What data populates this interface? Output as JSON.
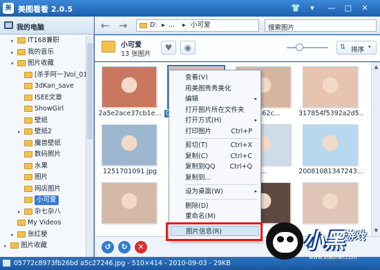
{
  "window": {
    "app_icon": "美",
    "title": "美图看看 2.0.5",
    "controls": [
      "shirt-icon",
      "menu-icon",
      "minimize-icon",
      "maximize-icon",
      "close-icon"
    ]
  },
  "sidebar": {
    "root_label": "我的电脑",
    "items": [
      {
        "label": "IT168兼职",
        "indent": 1,
        "expander": "▸"
      },
      {
        "label": "我的音乐",
        "indent": 1,
        "expander": "▸"
      },
      {
        "label": "图片收藏",
        "indent": 1,
        "expander": "▾"
      },
      {
        "label": "[杀手阿一]Vol_01",
        "indent": 2,
        "expander": ""
      },
      {
        "label": "3dKan_save",
        "indent": 2,
        "expander": ""
      },
      {
        "label": "ISEE文章",
        "indent": 2,
        "expander": ""
      },
      {
        "label": "ShowGirl",
        "indent": 2,
        "expander": ""
      },
      {
        "label": "壁纸",
        "indent": 2,
        "expander": ""
      },
      {
        "label": "壁纸2",
        "indent": 2,
        "expander": "▸"
      },
      {
        "label": "魔兽壁纸",
        "indent": 2,
        "expander": ""
      },
      {
        "label": "数码照片",
        "indent": 2,
        "expander": ""
      },
      {
        "label": "水果",
        "indent": 2,
        "expander": ""
      },
      {
        "label": "图片",
        "indent": 2,
        "expander": ""
      },
      {
        "label": "网店图片",
        "indent": 2,
        "expander": ""
      },
      {
        "label": "小可爱",
        "indent": 2,
        "expander": "",
        "selected": true
      },
      {
        "label": "杂七杂八",
        "indent": 2,
        "expander": "▸"
      },
      {
        "label": "My Videos",
        "indent": 1,
        "expander": ""
      },
      {
        "label": "张红梗",
        "indent": 1,
        "expander": "▸"
      },
      {
        "label": "图片收藏",
        "indent": 0,
        "expander": "▸"
      }
    ]
  },
  "toolbar": {
    "back": "←",
    "forward": "→",
    "path": {
      "drive": "D:",
      "sep1": "▸",
      "ellipsis": "...",
      "sep2": "▸",
      "folder": "小可爱"
    },
    "search_placeholder": "搜索图片"
  },
  "folder_header": {
    "name": "小可爱",
    "count": "13 张图片",
    "favorite_icon": "♥",
    "view_icon": "◉",
    "zoom_level": 0.3,
    "sort_label": "排序",
    "sort_arrow": "▾",
    "sort_icon": "⇅"
  },
  "thumbnails": [
    {
      "caption": "2a5e2ace37cb1e...",
      "color": "#c9785f",
      "selected": false
    },
    {
      "caption": "05772c8973fb26...",
      "color": "#e3b8a2",
      "selected": true
    },
    {
      "caption": "...9462c...",
      "color": "#d8b5a0",
      "selected": false
    },
    {
      "caption": "317854f5392a2d5...",
      "color": "#e7c3b0",
      "selected": false
    },
    {
      "caption": "1251701091.jpg",
      "color": "#9cb7cf",
      "selected": false
    },
    {
      "caption": "...",
      "color": "#b4c8dc",
      "selected": false
    },
    {
      "caption": "...",
      "color": "#cfdbe6",
      "selected": false
    },
    {
      "caption": "20081081347243...",
      "color": "#b7d8ee",
      "selected": false
    },
    {
      "caption": "",
      "color": "#d5b8a6",
      "selected": false
    },
    {
      "caption": "",
      "color": "#c7a593",
      "selected": false
    },
    {
      "caption": "",
      "color": "#5e4a40",
      "selected": false
    },
    {
      "caption": "",
      "color": "#e0c5b7",
      "selected": false
    }
  ],
  "context_menu": {
    "items": [
      {
        "label": "查看(V)",
        "shortcut": "",
        "arrow": ""
      },
      {
        "label": "用美图秀秀美化",
        "shortcut": "",
        "arrow": ""
      },
      {
        "label": "编辑",
        "shortcut": "",
        "arrow": "▸"
      },
      {
        "label": "打开图片所在文件夹",
        "shortcut": "",
        "arrow": ""
      },
      {
        "label": "打开方式(H)",
        "shortcut": "",
        "arrow": "▸"
      },
      {
        "label": "打印图片",
        "shortcut": "Ctrl+P",
        "arrow": ""
      },
      {
        "sep": true
      },
      {
        "label": "剪切(T)",
        "shortcut": "Ctrl+X",
        "arrow": ""
      },
      {
        "label": "复制(C)",
        "shortcut": "Ctrl+C",
        "arrow": ""
      },
      {
        "label": "复制到QQ",
        "shortcut": "Ctrl+Q",
        "arrow": ""
      },
      {
        "label": "复制到...",
        "shortcut": "",
        "arrow": ""
      },
      {
        "sep": true
      },
      {
        "label": "设为桌面(W)",
        "shortcut": "",
        "arrow": "▸"
      },
      {
        "sep": true
      },
      {
        "label": "删除(D)",
        "shortcut": "",
        "arrow": ""
      },
      {
        "label": "重命名(M)",
        "shortcut": "",
        "arrow": ""
      },
      {
        "sep": true
      },
      {
        "label": "图片信息(R)",
        "shortcut": "",
        "arrow": "",
        "highlighted": true
      }
    ]
  },
  "bottom_actions": {
    "rotate_left": "↺",
    "rotate_right": "↻",
    "delete": "✕"
  },
  "status": {
    "text": "05772c8973fb26bd a5c27246.jpg - 510×414 - 2010-09-03 - 29KB"
  },
  "watermark": {
    "big": "小黑",
    "game": "游戏",
    "url": "www.xiaohei.com"
  },
  "colors": {
    "accent": "#2f72c4",
    "title_bar": "#1c5fae",
    "highlight_box": "#e21919"
  }
}
